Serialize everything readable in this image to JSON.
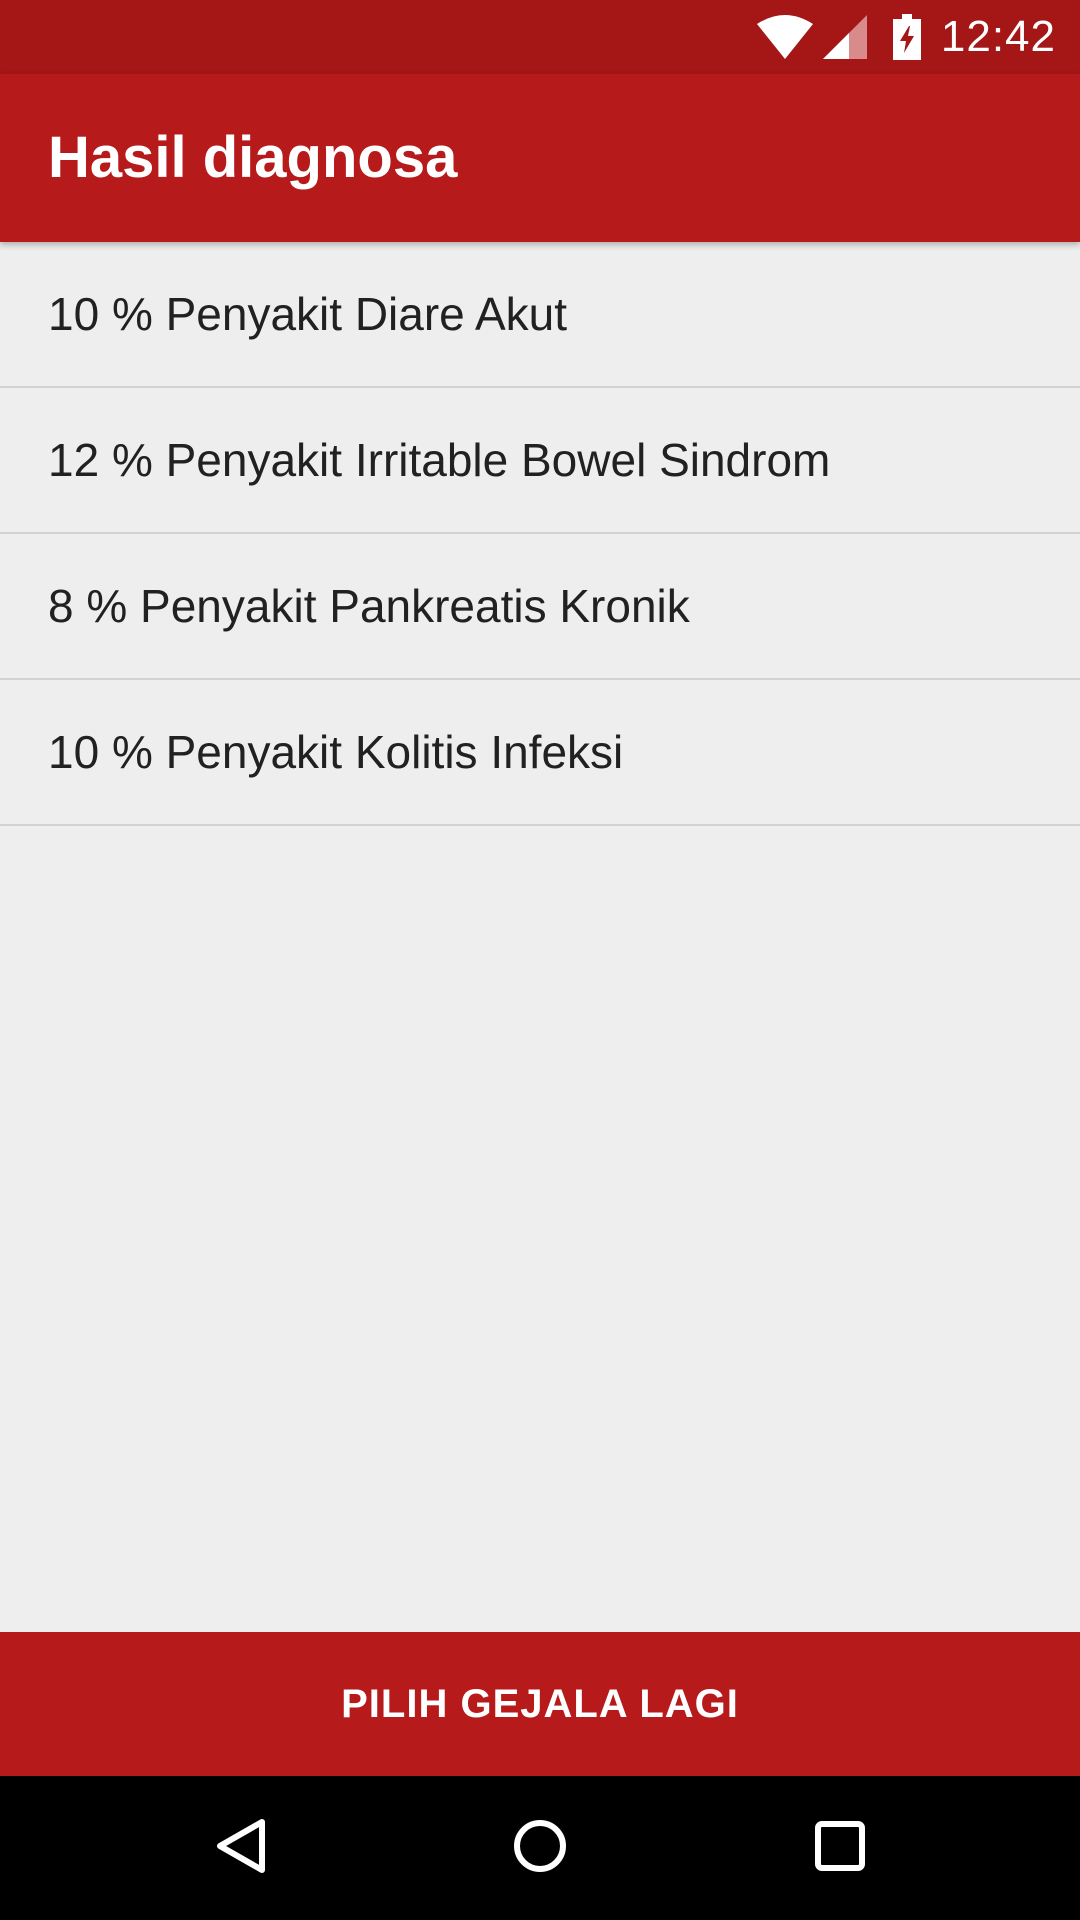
{
  "status_bar": {
    "time": "12:42",
    "icons": [
      "wifi-icon",
      "signal-icon",
      "battery-charging-icon"
    ]
  },
  "app_bar": {
    "title": "Hasil diagnosa"
  },
  "results": [
    {
      "label": "10 % Penyakit Diare Akut"
    },
    {
      "label": "12 % Penyakit Irritable Bowel Sindrom"
    },
    {
      "label": "8 % Penyakit Pankreatis Kronik"
    },
    {
      "label": "10 % Penyakit Kolitis Infeksi"
    }
  ],
  "action_button": {
    "label": "PILIH GEJALA LAGI"
  },
  "navigation": {
    "icons": [
      "back-icon",
      "home-icon",
      "recents-icon"
    ]
  },
  "colors": {
    "status_bar": "#A51616",
    "primary": "#B71A1A",
    "background": "#EEEEEE",
    "divider": "#D2D2D2",
    "text": "#212121",
    "nav_bar": "#000000"
  }
}
